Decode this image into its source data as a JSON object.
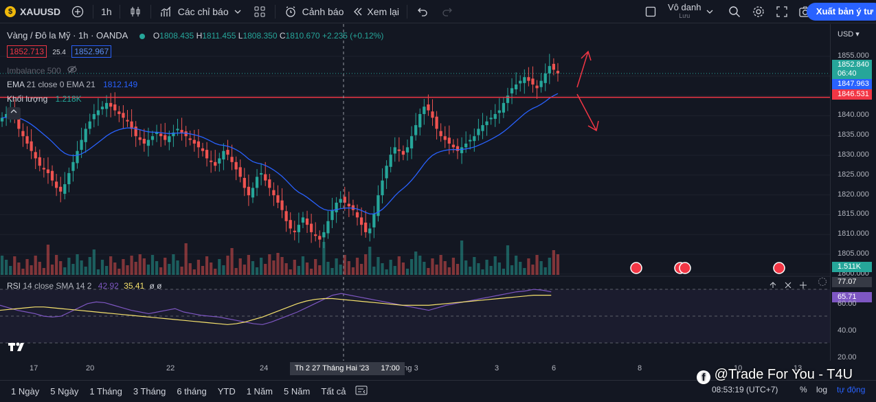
{
  "toolbar": {
    "symbol": "XAUUSD",
    "interval": "1h",
    "indicators_label": "Các chỉ báo",
    "alert_label": "Cảnh báo",
    "replay_label": "Xem lại",
    "layout_name": "Vô danh",
    "layout_sub": "Lưu",
    "export_label": "Xuất bản ý tư"
  },
  "legend": {
    "title": "Vàng / Đô la Mỹ · 1h · OANDA",
    "o_label": "O",
    "o": "1808.435",
    "h_label": "H",
    "h": "1811.455",
    "l_label": "L",
    "l": "1808.350",
    "c_label": "C",
    "c": "1810.670",
    "change": "+2.235 (+0.12%)",
    "sell": "1852.713",
    "spread": "25.4",
    "buy": "1852.967",
    "imbalance": "Imbalance 500",
    "ema_label": "EMA",
    "ema_params": "21 close 0 EMA 21",
    "ema_value": "1812.149",
    "volume_label": "Khối lượng",
    "volume_value": "1.218K"
  },
  "rsi": {
    "label": "RSI",
    "params": "14 close SMA 14 2",
    "value": "42.92",
    "sma_value": "35.41",
    "extra": "ø ø"
  },
  "axis": {
    "currency": "USD",
    "ticks": [
      "1855.000",
      "1850.000",
      "1845.000",
      "1840.000",
      "1835.000",
      "1830.000",
      "1825.000",
      "1820.000",
      "1815.000",
      "1810.000",
      "1805.000",
      "1800.000"
    ],
    "price_tag": "1852.840",
    "countdown": "06:40",
    "ema_tag": "1847.963",
    "line_tag": "1846.531",
    "volume_tag": "1.511K",
    "rsi_ticks": [
      "80.00",
      "60.00",
      "40.00",
      "20.00"
    ],
    "rsi_tag1": "77.07",
    "rsi_tag2": "65.71"
  },
  "xaxis": {
    "ticks": [
      "17",
      "20",
      "22",
      "24",
      "tháng 3",
      "3",
      "6",
      "8",
      "10",
      "13"
    ],
    "crosshair": "Th 2 27 Tháng Hai '23",
    "crosshair_time": "17:00"
  },
  "bottom": {
    "ranges": [
      "1 Ngày",
      "5 Ngày",
      "1 Tháng",
      "3 Tháng",
      "6 tháng",
      "YTD",
      "1 Năm",
      "5 Năm",
      "Tất cả"
    ],
    "clock": "08:53:19 (UTC+7)",
    "percent": "%",
    "log": "log",
    "auto": "tự động",
    "watermark": "@Trade For You - T4U"
  },
  "colors": {
    "up": "#26a69a",
    "down": "#ef5350",
    "ema": "#2962ff",
    "hline": "#f23645",
    "rsi": "#7e57c2",
    "rsi_sma": "#f7e36d",
    "accent": "#2962ff"
  },
  "chart_data": {
    "type": "candlestick",
    "symbol": "XAUUSD",
    "interval": "1h",
    "ylim": [
      1799,
      1858
    ],
    "horizontal_line": 1846.531,
    "closes": [
      1841,
      1842,
      1843,
      1841,
      1838,
      1836,
      1834,
      1832,
      1830,
      1828,
      1827,
      1826,
      1824,
      1822,
      1821,
      1823,
      1826,
      1829,
      1832,
      1835,
      1838,
      1840,
      1842,
      1843,
      1844,
      1845,
      1844,
      1843,
      1842,
      1841,
      1840,
      1838,
      1836,
      1835,
      1834,
      1835,
      1836,
      1837,
      1836,
      1835,
      1836,
      1837,
      1838,
      1837,
      1836,
      1835,
      1834,
      1833,
      1832,
      1830,
      1829,
      1828,
      1830,
      1832,
      1831,
      1829,
      1827,
      1825,
      1822,
      1820,
      1822,
      1825,
      1826,
      1824,
      1822,
      1820,
      1818,
      1816,
      1813,
      1811,
      1810,
      1812,
      1814,
      1812,
      1810,
      1809,
      1808,
      1810,
      1813,
      1816,
      1818,
      1819,
      1818,
      1817,
      1816,
      1814,
      1812,
      1810,
      1811,
      1815,
      1820,
      1824,
      1828,
      1831,
      1833,
      1832,
      1831,
      1833,
      1836,
      1839,
      1842,
      1844,
      1843,
      1841,
      1838,
      1836,
      1835,
      1834,
      1833,
      1832,
      1833,
      1834,
      1835,
      1836,
      1838,
      1839,
      1840,
      1841,
      1842,
      1843,
      1845,
      1847,
      1849,
      1850,
      1851,
      1852,
      1851,
      1850,
      1849,
      1851,
      1853,
      1855,
      1854,
      1853
    ],
    "rsi": [
      58,
      55,
      52,
      50,
      48,
      45,
      44,
      45,
      50,
      55,
      60,
      62,
      61,
      58,
      55,
      52,
      50,
      48,
      50,
      52,
      54,
      50,
      48,
      46,
      45,
      44,
      42,
      40,
      38,
      36,
      35,
      38,
      42,
      46,
      50,
      55,
      60,
      65,
      70,
      72,
      70,
      68,
      66,
      64,
      62,
      60,
      58,
      56,
      54,
      52,
      55,
      58,
      60,
      62,
      64,
      66,
      68,
      70,
      72,
      74,
      75,
      77,
      76,
      74
    ],
    "rsi_sma": [
      52,
      53,
      54,
      55,
      56,
      56,
      55,
      54,
      53,
      52,
      51,
      50,
      49,
      48,
      47,
      46,
      45,
      44,
      43,
      42,
      41,
      40,
      39,
      38,
      37,
      36,
      35,
      36,
      38,
      41,
      44,
      48,
      52,
      56,
      60,
      63,
      65,
      66,
      66,
      65,
      64,
      63,
      62,
      61,
      60,
      59,
      58,
      58,
      58,
      58,
      59,
      60,
      61,
      62,
      63,
      64,
      65,
      66,
      67,
      68,
      69,
      70,
      70,
      70
    ]
  }
}
